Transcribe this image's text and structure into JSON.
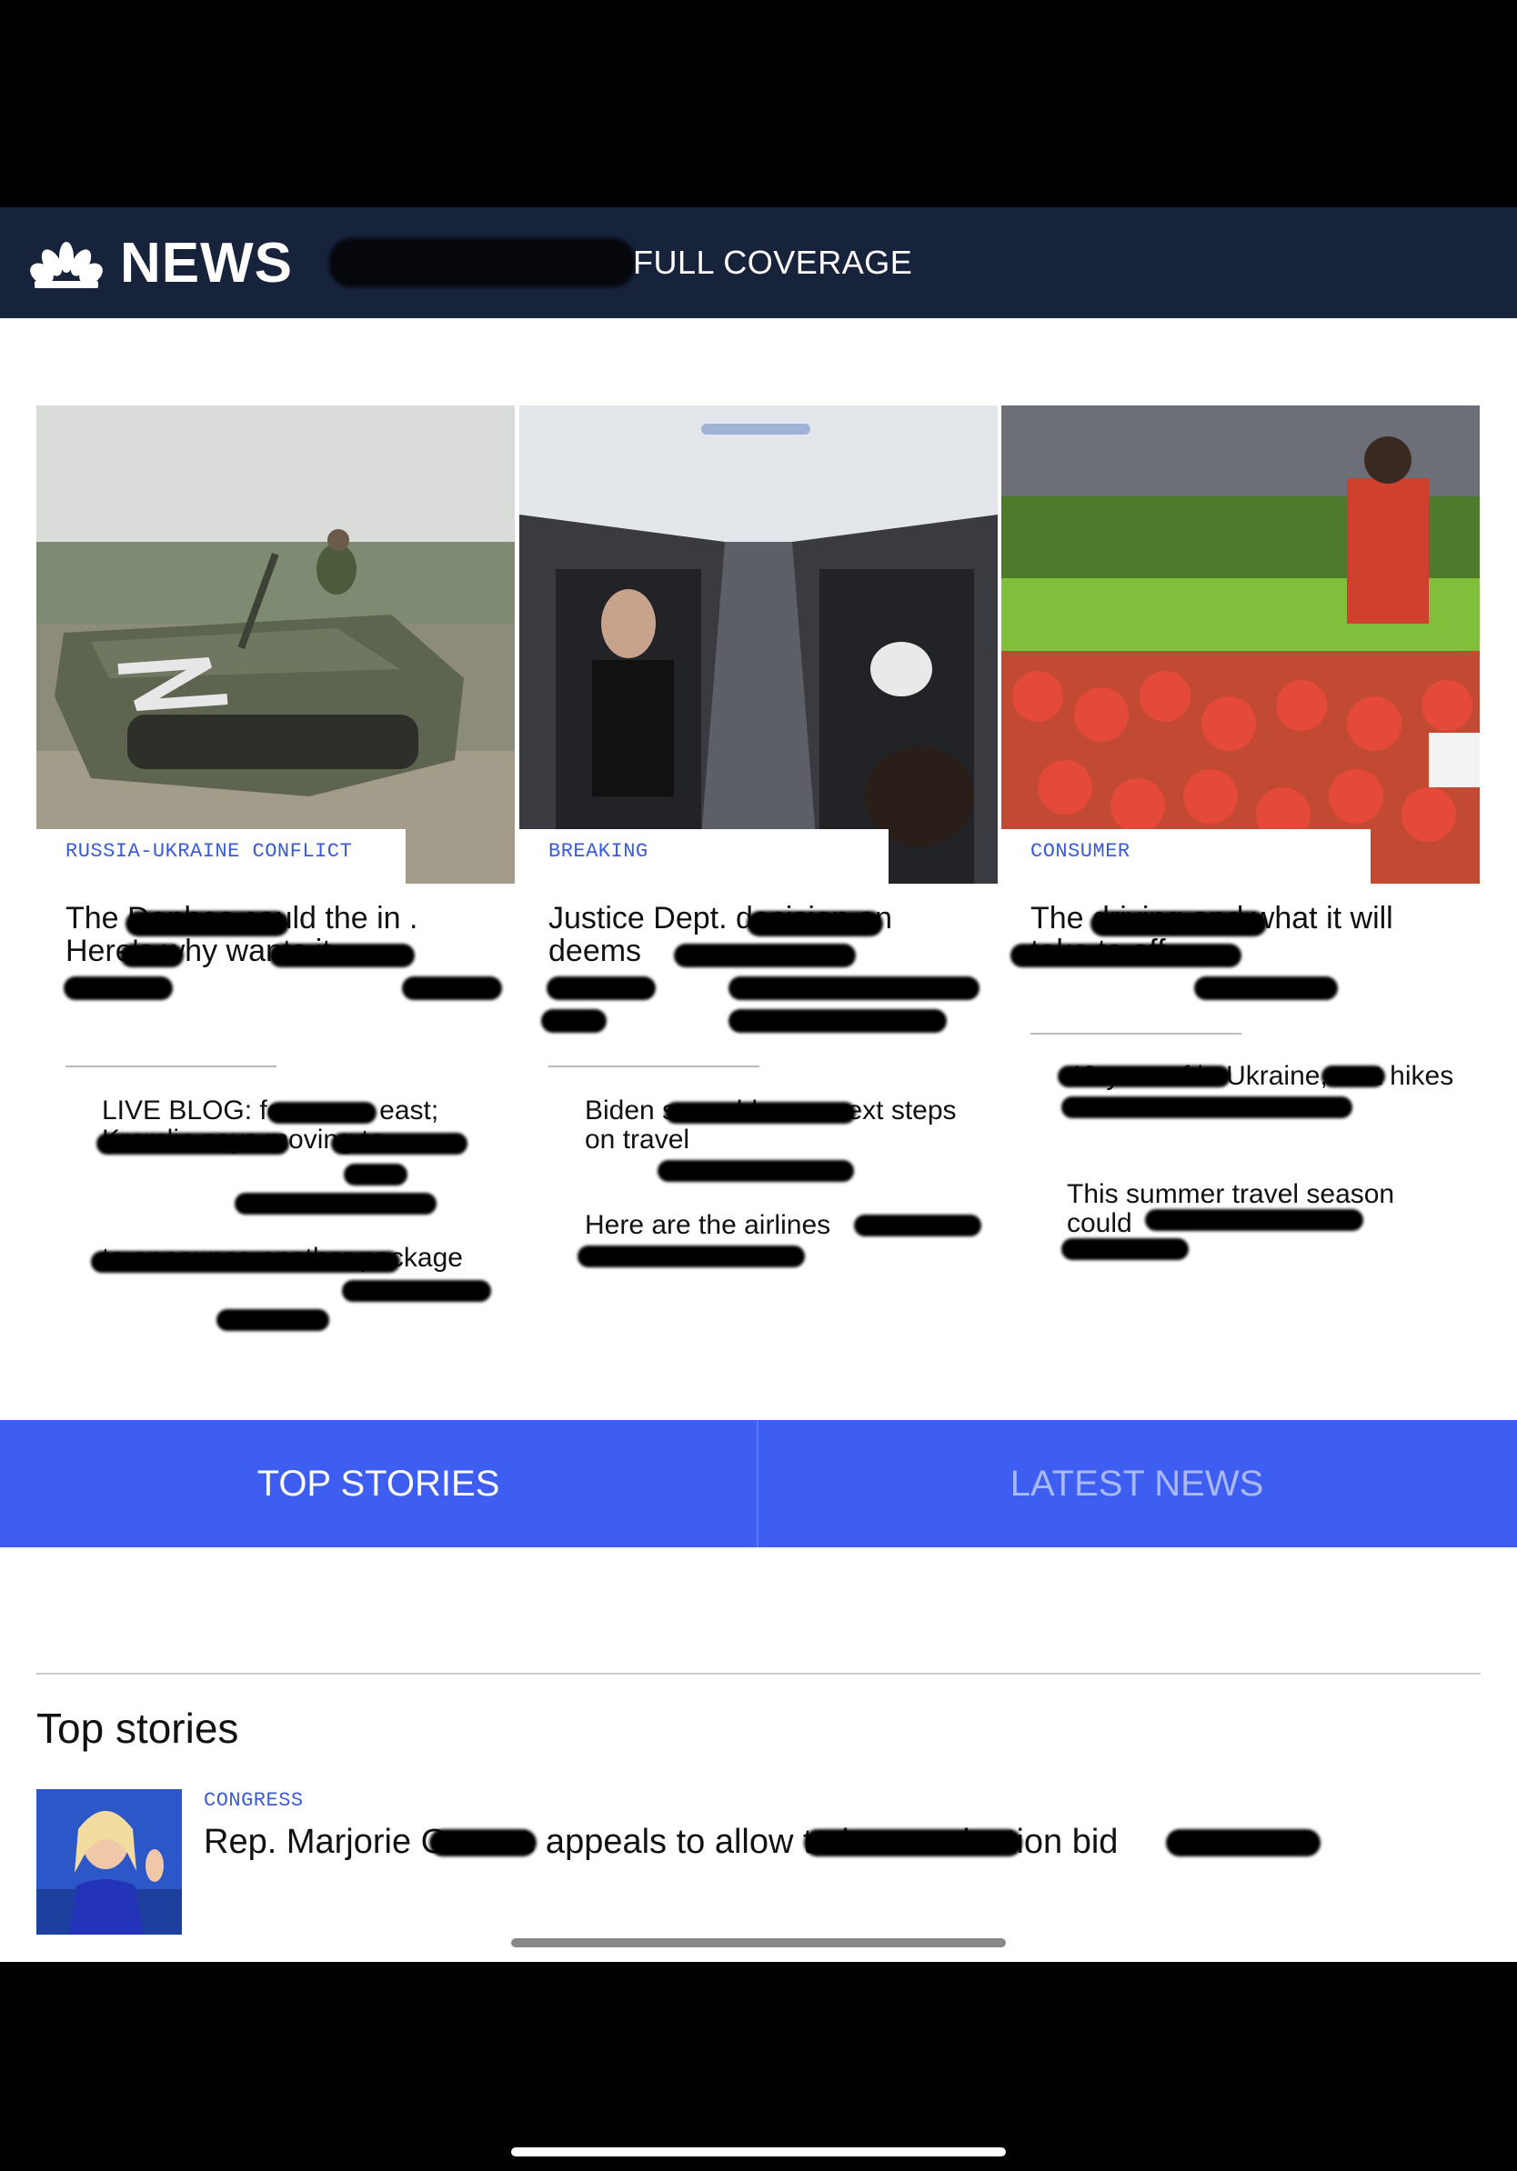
{
  "nav": {
    "brand": "NEWS",
    "full_coverage": "FULL COVERAGE",
    "account_icon": "account-circle-icon",
    "menu_icon": "hamburger-menu-icon"
  },
  "cards": [
    {
      "label": "RUSSIA-UKRAINE CONFLICT",
      "headline": "The Donbas could the in . Here's why wants it.",
      "related": [
        "LIVE BLOG: forces on east; Kremlin says moving to",
        "to announce another package"
      ]
    },
    {
      "label": "BREAKING",
      "headline": "Justice Dept. decision on deems",
      "related": [
        "Biden scrambles on next steps on travel",
        "Here are the airlines"
      ]
    },
    {
      "label": "CONSUMER",
      "headline": "The driving and what it will take to off",
      "related": [
        "40-year of in Ukraine, rent hikes",
        "This summer travel season could"
      ]
    }
  ],
  "tabs": {
    "top_stories": "TOP STORIES",
    "latest_news": "LATEST NEWS"
  },
  "section": {
    "title": "Top stories",
    "story": {
      "label": "CONGRESS",
      "headline": "Rep. Marjorie Greene appeals to allow to her re-election bid"
    }
  },
  "colors": {
    "nav_bg": "#17223b",
    "accent_blue": "#3d5ef0",
    "label_blue": "#3a5bd9"
  }
}
